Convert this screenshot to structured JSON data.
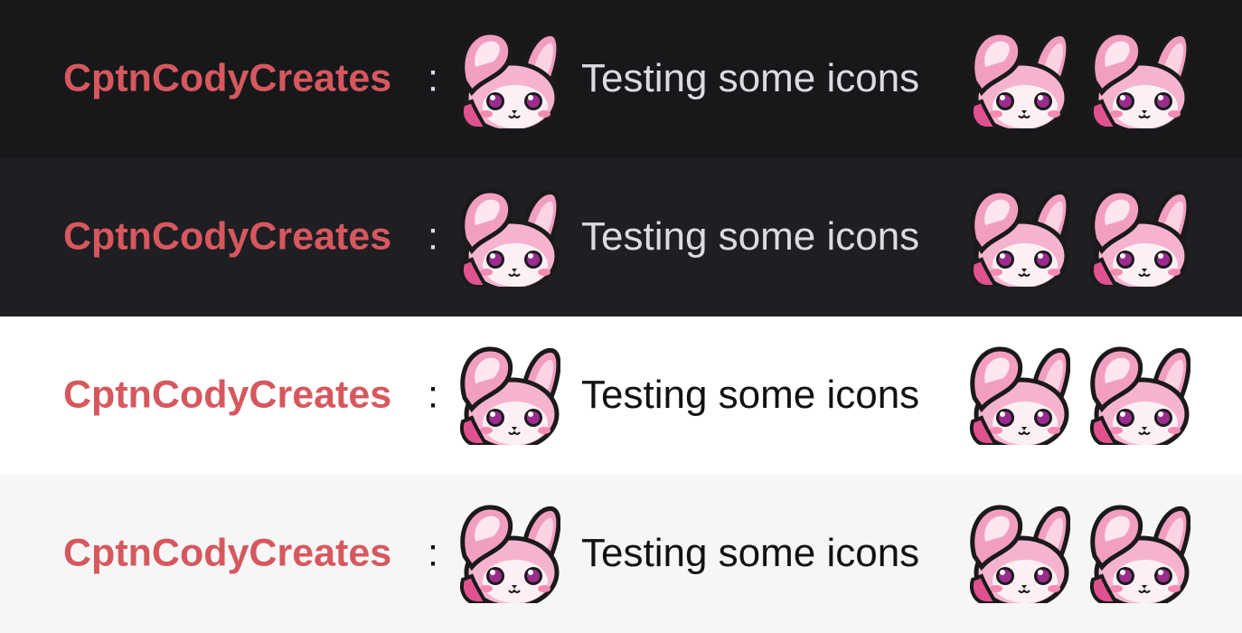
{
  "rows": [
    {
      "theme": "dark",
      "background": "#18181b",
      "username": "CptnCodyCreates",
      "separator": ":",
      "message": "Testing some icons",
      "emotes": [
        "bunny-salute-emote",
        "bunny-salute-emote",
        "bunny-salute-emote"
      ]
    },
    {
      "theme": "dark-alt",
      "background": "#1f1e23",
      "username": "CptnCodyCreates",
      "separator": ":",
      "message": "Testing some icons",
      "emotes": [
        "bunny-salute-emote",
        "bunny-salute-emote",
        "bunny-salute-emote"
      ]
    },
    {
      "theme": "light",
      "background": "#ffffff",
      "username": "CptnCodyCreates",
      "separator": ":",
      "message": "Testing some icons",
      "emotes": [
        "bunny-salute-emote",
        "bunny-salute-emote",
        "bunny-salute-emote"
      ]
    },
    {
      "theme": "light-alt",
      "background": "#f6f6f6",
      "username": "CptnCodyCreates",
      "separator": ":",
      "message": "Testing some icons",
      "emotes": [
        "bunny-salute-emote",
        "bunny-salute-emote",
        "bunny-salute-emote"
      ]
    }
  ],
  "colors": {
    "username": "#d6585e",
    "emote_pink": "#f29ec0",
    "emote_dark_pink": "#e0528f",
    "emote_eye": "#9b2c8e"
  }
}
